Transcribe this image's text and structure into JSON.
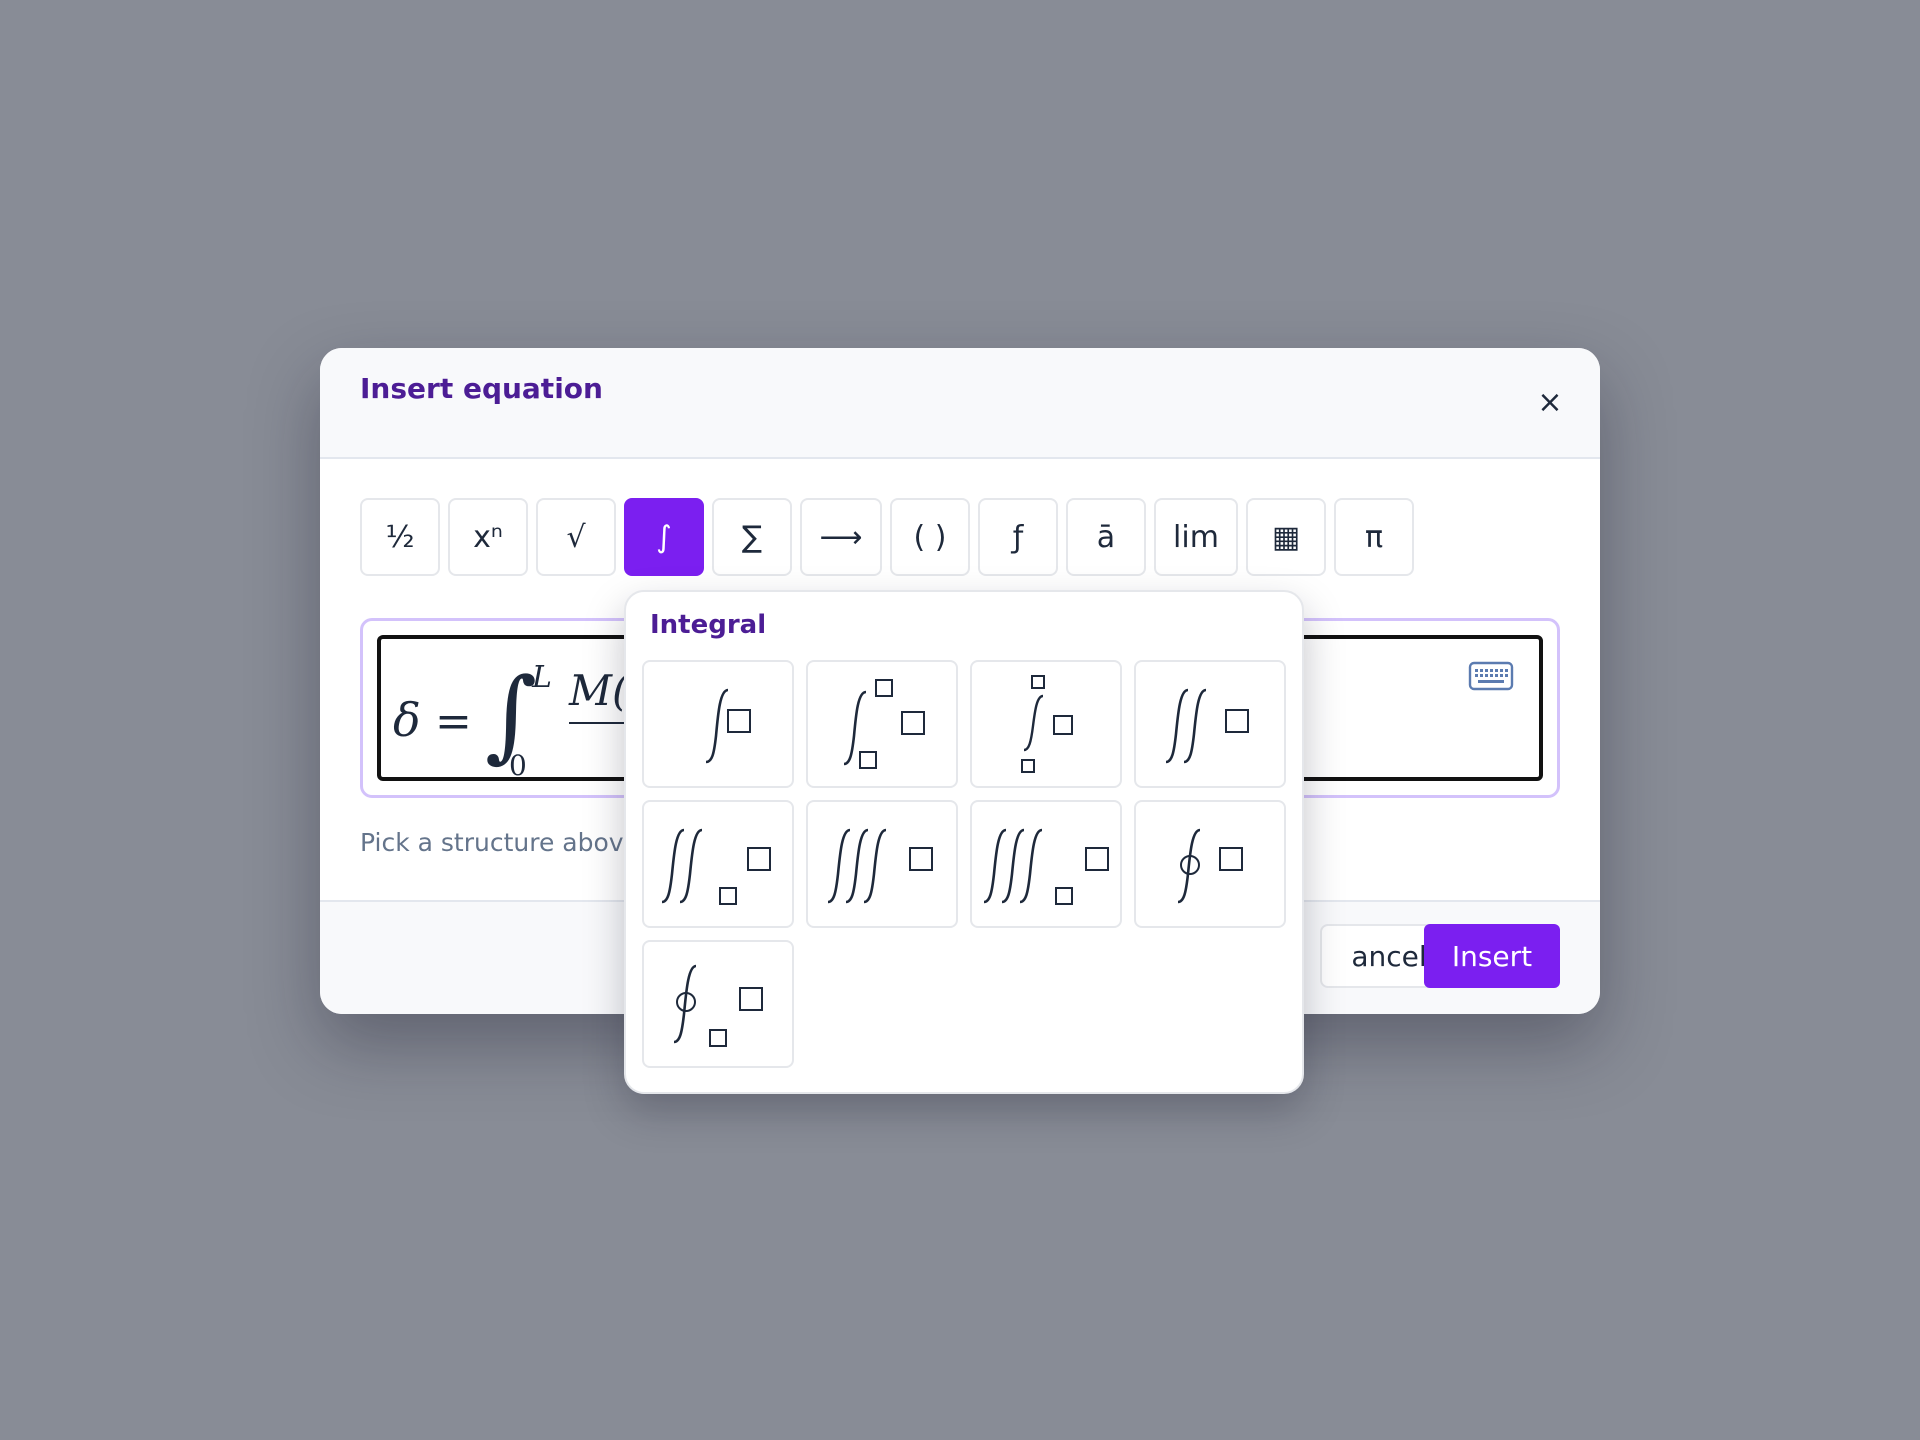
{
  "dialog": {
    "title": "Insert equation",
    "close_symbol": "×",
    "hint": "Pick a structure abov",
    "cancel_label": "ancel",
    "insert_label": "Insert"
  },
  "toolbar": [
    {
      "symbol": "½",
      "icon": "fraction-icon"
    },
    {
      "symbol": "xⁿ",
      "icon": "superscript-icon"
    },
    {
      "symbol": "√",
      "icon": "radical-icon"
    },
    {
      "symbol": "∫",
      "icon": "integral-icon",
      "active": true
    },
    {
      "symbol": "∑",
      "icon": "sum-icon"
    },
    {
      "symbol": "⟶",
      "icon": "arrow-icon"
    },
    {
      "symbol": "( )",
      "icon": "brackets-icon"
    },
    {
      "symbol": "ƒ",
      "icon": "function-icon"
    },
    {
      "symbol": "ā",
      "icon": "accent-icon"
    },
    {
      "symbol": "lim",
      "icon": "limit-icon"
    },
    {
      "symbol": "▦",
      "icon": "matrix-icon"
    },
    {
      "symbol": "π",
      "icon": "greek-icon"
    }
  ],
  "equation": {
    "lhs": "δ",
    "equals": "=",
    "integral": "∫",
    "upper_limit": "L",
    "lower_limit": "0",
    "numerator_visible": "M("
  },
  "popover": {
    "title": "Integral",
    "templates": [
      "integral",
      "integral-with-limits",
      "integral-with-stacked-limits",
      "double-integral",
      "double-integral-with-subscript",
      "triple-integral",
      "triple-integral-with-subscript",
      "contour-integral",
      "contour-integral-with-subscript"
    ]
  },
  "colors": {
    "accent": "#7b1ff0",
    "title": "#4c1d95",
    "overlay": "#888c96"
  }
}
